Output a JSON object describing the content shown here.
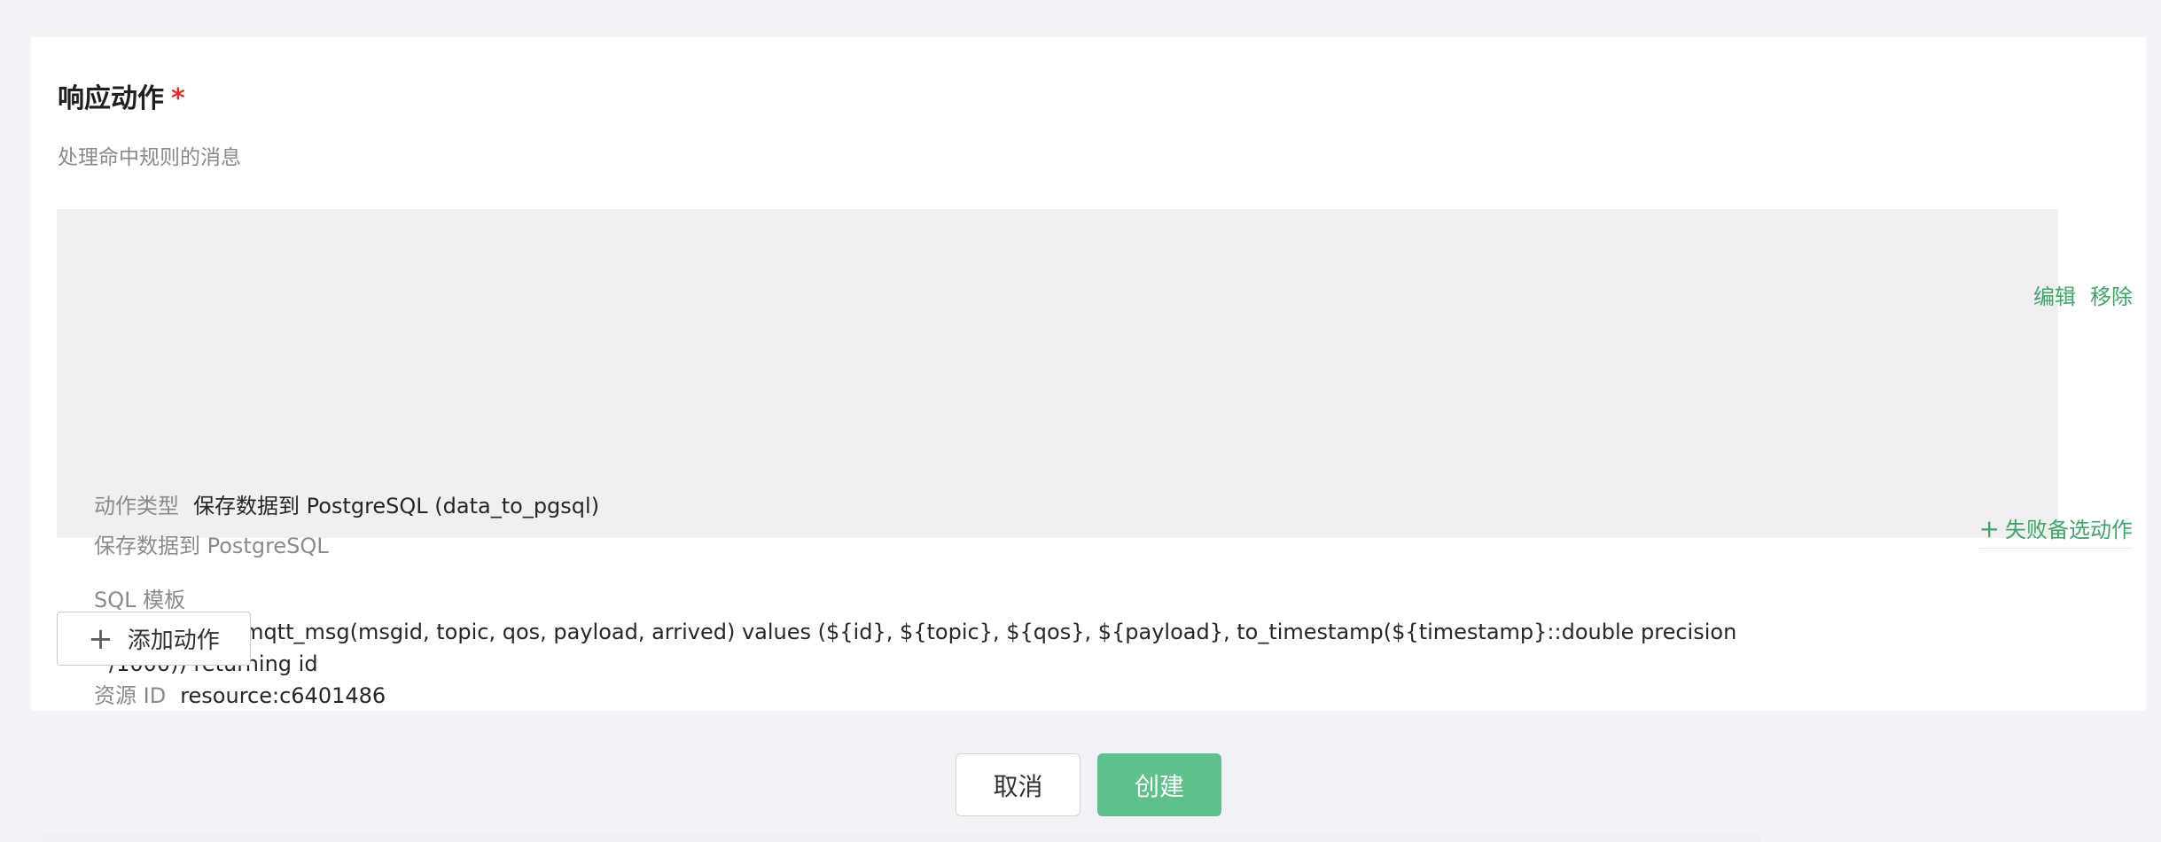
{
  "section": {
    "title": "响应动作",
    "required_marker": "*",
    "description": "处理命中规则的消息"
  },
  "action": {
    "type_label": "动作类型",
    "type_value": "保存数据到 PostgreSQL (data_to_pgsql)",
    "description": "保存数据到 PostgreSQL",
    "edit_label": "编辑",
    "remove_label": "移除",
    "sql_label": "SQL 模板",
    "sql_line_1": "insert into t_mqtt_msg(msgid, topic, qos, payload, arrived) values (${id}, ${topic}, ${qos}, ${payload}, to_timestamp(${timestamp}::double precision",
    "sql_line_2": "/1000)) returning id",
    "resource_label": "资源 ID",
    "resource_value": "resource:c6401486",
    "fallback_label": "失败备选动作",
    "fallback_icon": "plus-icon"
  },
  "add_action": {
    "label": "添加动作",
    "icon": "plus-icon"
  },
  "footer": {
    "cancel_label": "取消",
    "create_label": "创建"
  },
  "colors": {
    "accent": "#5ec08a",
    "link": "#3fa568",
    "required": "#e0302a"
  }
}
